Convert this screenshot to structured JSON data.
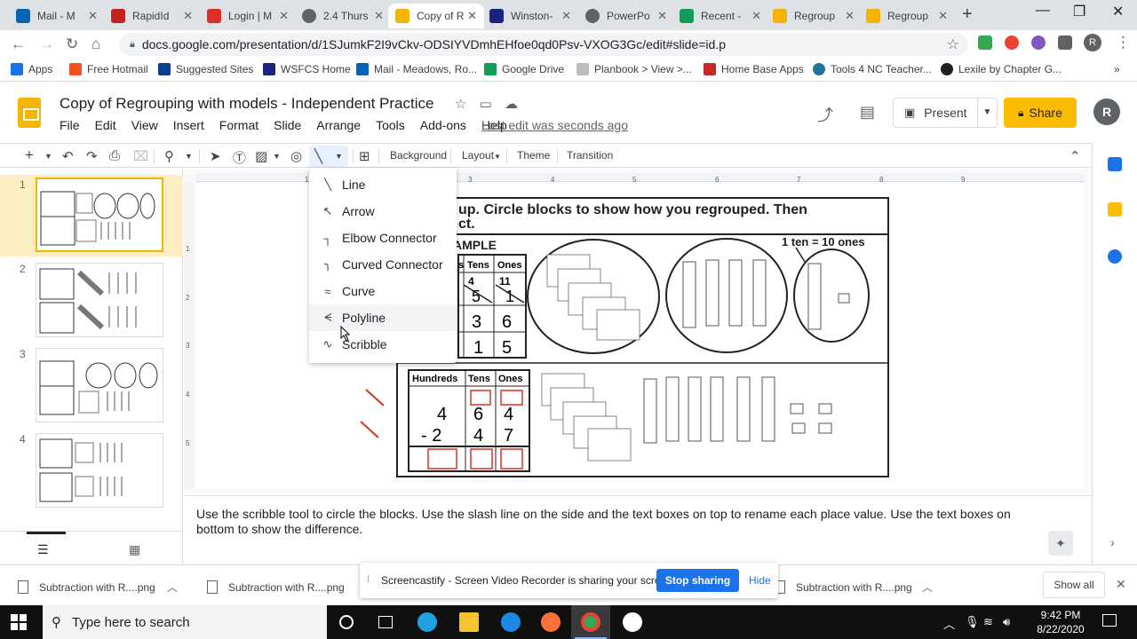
{
  "browser": {
    "tabs": [
      {
        "title": "Mail - M",
        "color": "#0364b8"
      },
      {
        "title": "RapidId",
        "color": "#c5221f"
      },
      {
        "title": "Login | M",
        "color": "#d93025"
      },
      {
        "title": "2.4 Thurs",
        "color": "#5f6368"
      },
      {
        "title": "Copy of R",
        "color": "#f4b400"
      },
      {
        "title": "Winston-",
        "color": "#1a237e"
      },
      {
        "title": "PowerPo",
        "color": "#5f6368"
      },
      {
        "title": "Recent -",
        "color": "#0f9d58"
      },
      {
        "title": "Regroup",
        "color": "#f4b400"
      },
      {
        "title": "Regroup",
        "color": "#f4b400"
      }
    ],
    "url": "docs.google.com/presentation/d/1SJumkF2I9vCkv-ODSIYVDmhEHfoe0qd0Psv-VXOG3Gc/edit#slide=id.p",
    "profile_initial": "R",
    "bookmarks": [
      "Apps",
      "Free Hotmail",
      "Suggested Sites",
      "WSFCS Home",
      "Mail - Meadows, Ro...",
      "Google Drive",
      "Planbook > View >...",
      "Home Base Apps",
      "Tools 4 NC Teacher...",
      "Lexile by Chapter G..."
    ]
  },
  "slides": {
    "title": "Copy of Regrouping with models - Independent Practice",
    "menu": [
      "File",
      "Edit",
      "View",
      "Insert",
      "Format",
      "Slide",
      "Arrange",
      "Tools",
      "Add-ons",
      "Help"
    ],
    "last_edit": "Last edit was seconds ago",
    "present_label": "Present",
    "share_label": "Share",
    "user_initial": "R",
    "toolbar_text": {
      "background": "Background",
      "layout": "Layout",
      "theme": "Theme",
      "transition": "Transition"
    },
    "slide_numbers": [
      "1",
      "2",
      "3",
      "4"
    ],
    "line_menu": [
      "Line",
      "Arrow",
      "Elbow Connector",
      "Curved Connector",
      "Curve",
      "Polyline",
      "Scribble"
    ],
    "ruler_top": [
      "1",
      "2",
      "3",
      "4",
      "5",
      "6",
      "7",
      "8",
      "9"
    ],
    "ruler_left": [
      "1",
      "2",
      "3",
      "4",
      "5"
    ],
    "speaker_notes": "Use the scribble tool to circle the blocks. Use the slash line on the side and the text boxes on top to rename each place value. Use the text boxes on bottom to show the difference.",
    "slide_content": {
      "instruction": "up. Circle blocks to show how you regrouped. Then",
      "instruction2": "ct.",
      "example": "AMPLE",
      "ten_label": "1 ten = 10 ones",
      "top_headers": [
        "s",
        "Tens",
        "Ones"
      ],
      "top_regroup": [
        "4",
        "11"
      ],
      "top_row1": [
        "5",
        "1"
      ],
      "top_row2": [
        "3",
        "6"
      ],
      "top_row3": [
        "1",
        "5"
      ],
      "bottom_headers": [
        "Hundreds",
        "Tens",
        "Ones"
      ],
      "bottom_row1": [
        "4",
        "6",
        "4"
      ],
      "bottom_row2": [
        "- 2",
        "4",
        "7"
      ]
    }
  },
  "downloads": [
    "Subtraction with R....png",
    "Subtraction with R....png",
    "Subtraction with R....png"
  ],
  "show_all": "Show all",
  "screencastify": {
    "message": "Screencastify - Screen Video Recorder is sharing your screen.",
    "stop": "Stop sharing",
    "hide": "Hide"
  },
  "taskbar": {
    "search_placeholder": "Type here to search",
    "time": "9:42 PM",
    "date": "8/22/2020"
  }
}
